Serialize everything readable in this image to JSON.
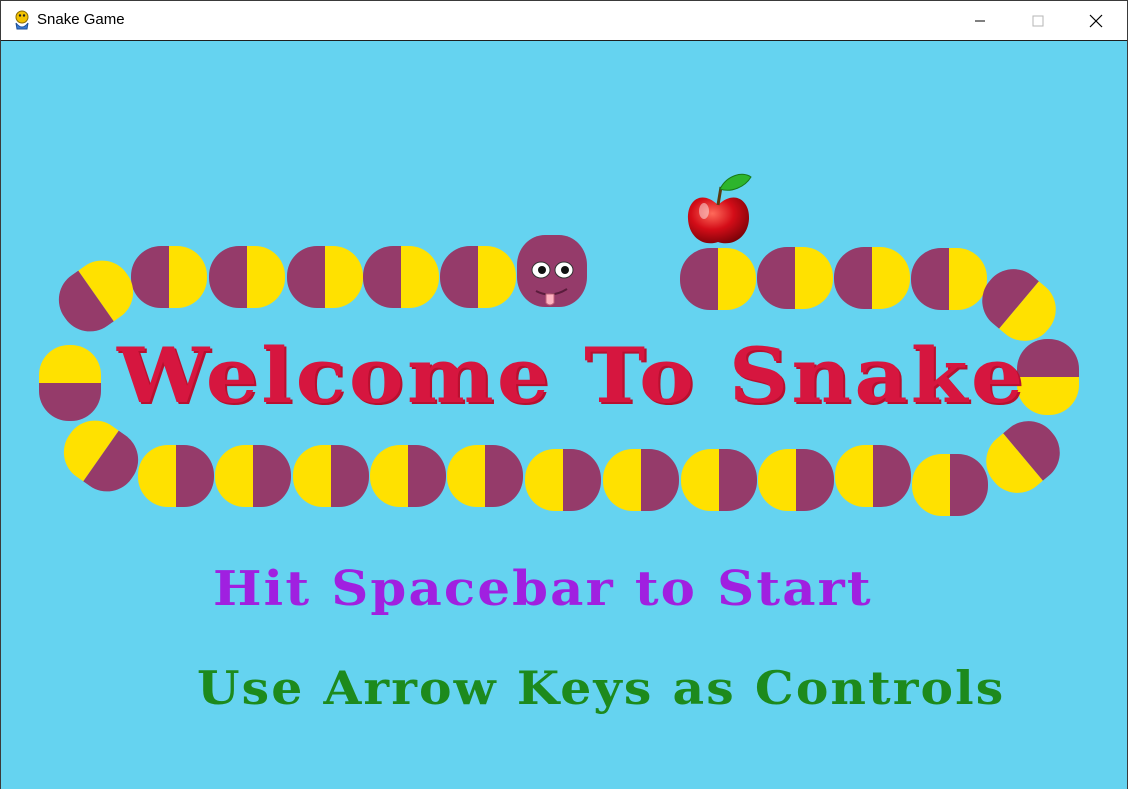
{
  "window": {
    "title": "Snake Game",
    "icon": "python-snake-icon",
    "buttons": {
      "minimize": "minimize-icon",
      "maximize": "maximize-icon",
      "close": "close-icon"
    }
  },
  "game": {
    "welcome_text": "Welcome To Snake",
    "start_text": "Hit Spacebar to Start",
    "controls_text": "Use Arrow Keys as Controls",
    "colors": {
      "background": "#65d3f0",
      "segment_purple": "#953b6a",
      "segment_yellow": "#ffe100",
      "head": "#953b6a",
      "apple": "#d40d18",
      "leaf": "#2db52d",
      "welcome": "#d6163f",
      "start": "#a020e0",
      "controls": "#1d8a1d"
    }
  }
}
